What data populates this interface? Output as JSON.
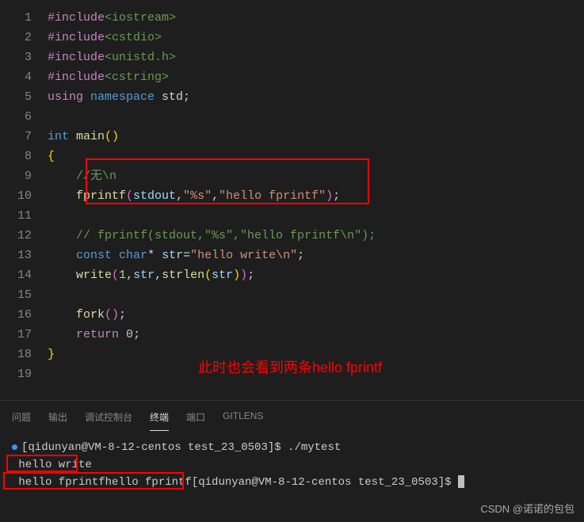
{
  "editor": {
    "lines": [
      {
        "n": "1",
        "tokens": [
          {
            "c": "kw-pink",
            "t": "#include"
          },
          {
            "c": "string-green",
            "t": "<iostream>"
          }
        ]
      },
      {
        "n": "2",
        "tokens": [
          {
            "c": "kw-pink",
            "t": "#include"
          },
          {
            "c": "string-green",
            "t": "<cstdio>"
          }
        ]
      },
      {
        "n": "3",
        "tokens": [
          {
            "c": "kw-pink",
            "t": "#include"
          },
          {
            "c": "string-green",
            "t": "<unistd.h>"
          }
        ]
      },
      {
        "n": "4",
        "tokens": [
          {
            "c": "kw-pink",
            "t": "#include"
          },
          {
            "c": "string-green",
            "t": "<cstring>"
          }
        ]
      },
      {
        "n": "5",
        "tokens": [
          {
            "c": "kw-pink",
            "t": "using"
          },
          {
            "c": "punc",
            "t": " "
          },
          {
            "c": "kw-blue",
            "t": "namespace"
          },
          {
            "c": "punc",
            "t": " std;"
          }
        ]
      },
      {
        "n": "6",
        "tokens": []
      },
      {
        "n": "7",
        "tokens": [
          {
            "c": "kw-blue",
            "t": "int"
          },
          {
            "c": "punc",
            "t": " "
          },
          {
            "c": "fn-yellow",
            "t": "main"
          },
          {
            "c": "brace-yellow",
            "t": "()"
          }
        ]
      },
      {
        "n": "8",
        "tokens": [
          {
            "c": "brace-yellow",
            "t": "{"
          }
        ]
      },
      {
        "n": "9",
        "indent": "    ",
        "tokens": [
          {
            "c": "comment",
            "t": "//无\\n"
          }
        ]
      },
      {
        "n": "10",
        "indent": "    ",
        "tokens": [
          {
            "c": "fn-yellow",
            "t": "fprintf"
          },
          {
            "c": "brace-pink",
            "t": "("
          },
          {
            "c": "var-blue",
            "t": "stdout"
          },
          {
            "c": "punc",
            "t": ","
          },
          {
            "c": "string-orange",
            "t": "\"%s\""
          },
          {
            "c": "punc",
            "t": ","
          },
          {
            "c": "string-orange",
            "t": "\"hello fprintf\""
          },
          {
            "c": "brace-pink",
            "t": ")"
          },
          {
            "c": "punc",
            "t": ";"
          }
        ]
      },
      {
        "n": "11",
        "tokens": []
      },
      {
        "n": "12",
        "indent": "    ",
        "tokens": [
          {
            "c": "comment",
            "t": "// fprintf(stdout,\"%s\",\"hello fprintf\\n\");"
          }
        ]
      },
      {
        "n": "13",
        "indent": "    ",
        "tokens": [
          {
            "c": "kw-blue",
            "t": "const"
          },
          {
            "c": "punc",
            "t": " "
          },
          {
            "c": "kw-blue",
            "t": "char"
          },
          {
            "c": "punc",
            "t": "* "
          },
          {
            "c": "var-blue",
            "t": "str"
          },
          {
            "c": "punc",
            "t": "="
          },
          {
            "c": "string-orange",
            "t": "\"hello write\\n\""
          },
          {
            "c": "punc",
            "t": ";"
          }
        ]
      },
      {
        "n": "14",
        "indent": "    ",
        "tokens": [
          {
            "c": "fn-yellow",
            "t": "write"
          },
          {
            "c": "brace-pink",
            "t": "("
          },
          {
            "c": "num",
            "t": "1"
          },
          {
            "c": "punc",
            "t": ","
          },
          {
            "c": "var-blue",
            "t": "str"
          },
          {
            "c": "punc",
            "t": ","
          },
          {
            "c": "fn-yellow",
            "t": "strlen"
          },
          {
            "c": "brace-yellow",
            "t": "("
          },
          {
            "c": "var-blue",
            "t": "str"
          },
          {
            "c": "brace-yellow",
            "t": ")"
          },
          {
            "c": "brace-pink",
            "t": ")"
          },
          {
            "c": "punc",
            "t": ";"
          }
        ]
      },
      {
        "n": "15",
        "tokens": []
      },
      {
        "n": "16",
        "indent": "    ",
        "tokens": [
          {
            "c": "fn-yellow",
            "t": "fork"
          },
          {
            "c": "brace-pink",
            "t": "()"
          },
          {
            "c": "punc",
            "t": ";"
          }
        ]
      },
      {
        "n": "17",
        "indent": "    ",
        "tokens": [
          {
            "c": "kw-pink",
            "t": "return"
          },
          {
            "c": "punc",
            "t": " "
          },
          {
            "c": "num",
            "t": "0"
          },
          {
            "c": "punc",
            "t": ";"
          }
        ]
      },
      {
        "n": "18",
        "tokens": [
          {
            "c": "brace-yellow",
            "t": "}"
          }
        ]
      },
      {
        "n": "19",
        "tokens": []
      }
    ]
  },
  "annotation": "此时也会看到两条hello fprintf",
  "tabs": {
    "items": [
      {
        "label": "问题",
        "active": false
      },
      {
        "label": "输出",
        "active": false
      },
      {
        "label": "调试控制台",
        "active": false
      },
      {
        "label": "终端",
        "active": true
      },
      {
        "label": "端口",
        "active": false
      },
      {
        "label": "GITLENS",
        "active": false
      }
    ]
  },
  "terminal": {
    "lines": [
      {
        "dot": true,
        "text": "[qidunyan@VM-8-12-centos test_23_0503]$ ./mytest"
      },
      {
        "text": " hello write"
      },
      {
        "text": " hello fprintfhello fprintf[qidunyan@VM-8-12-centos test_23_0503]$ ",
        "cursor": true
      }
    ]
  },
  "watermark": "CSDN @诺诺的包包"
}
